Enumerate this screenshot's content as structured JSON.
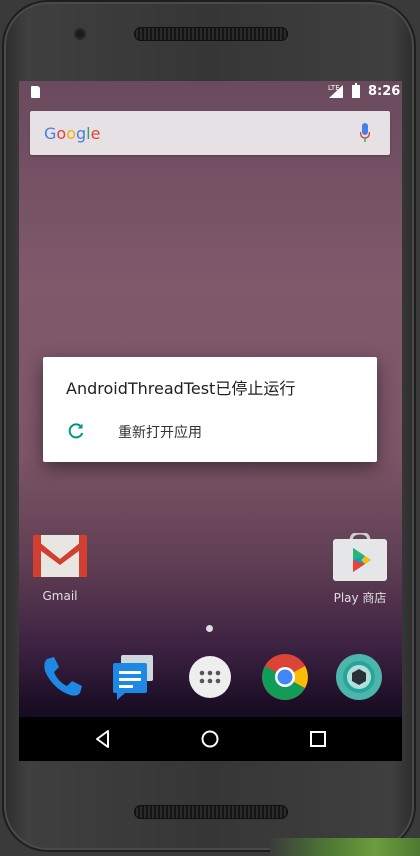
{
  "status_bar": {
    "time": "8:26",
    "network": "LTE"
  },
  "search_widget": {
    "logo": "Google",
    "icons": [
      "mic-icon"
    ]
  },
  "home_apps": [
    {
      "label": "Gmail",
      "icon": "gmail-icon"
    },
    {
      "label": "Play 商店",
      "icon": "play-store-icon"
    }
  ],
  "dock": [
    "phone-icon",
    "messages-icon",
    "app-drawer-icon",
    "chrome-icon",
    "camera-icon"
  ],
  "nav": [
    "back-icon",
    "home-icon",
    "recents-icon"
  ],
  "dialog": {
    "title": "AndroidThreadTest已停止运行",
    "option": "重新打开应用",
    "accent": "#009688"
  }
}
